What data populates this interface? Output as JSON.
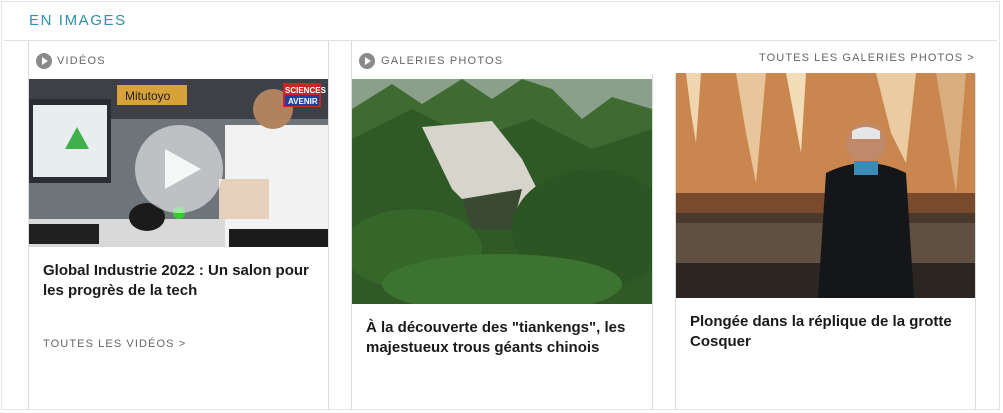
{
  "section": {
    "title": "EN IMAGES"
  },
  "videos": {
    "label": "VIDÉOS",
    "items": [
      {
        "title": "Global Industrie 2022 : Un salon pour les progrès de la tech",
        "logo_line1": "SCIENCES",
        "logo_line2": "AVENIR",
        "booth_sign": "Mitutoyo"
      }
    ],
    "all_link": "TOUTES LES VIDÉOS >"
  },
  "galleries": {
    "label": "GALERIES PHOTOS",
    "all_link": "TOUTES LES GALERIES PHOTOS >",
    "items": [
      {
        "title": "À la découverte des \"tiankengs\", les majestueux trous géants chinois"
      },
      {
        "title": "Plongée dans la réplique de la grotte Cosquer"
      }
    ]
  },
  "colors": {
    "accent": "#2f8fae",
    "play_badge": "#8a8a8a"
  },
  "icons": {
    "play": "play-icon",
    "chevron": "chevron-right-icon"
  }
}
